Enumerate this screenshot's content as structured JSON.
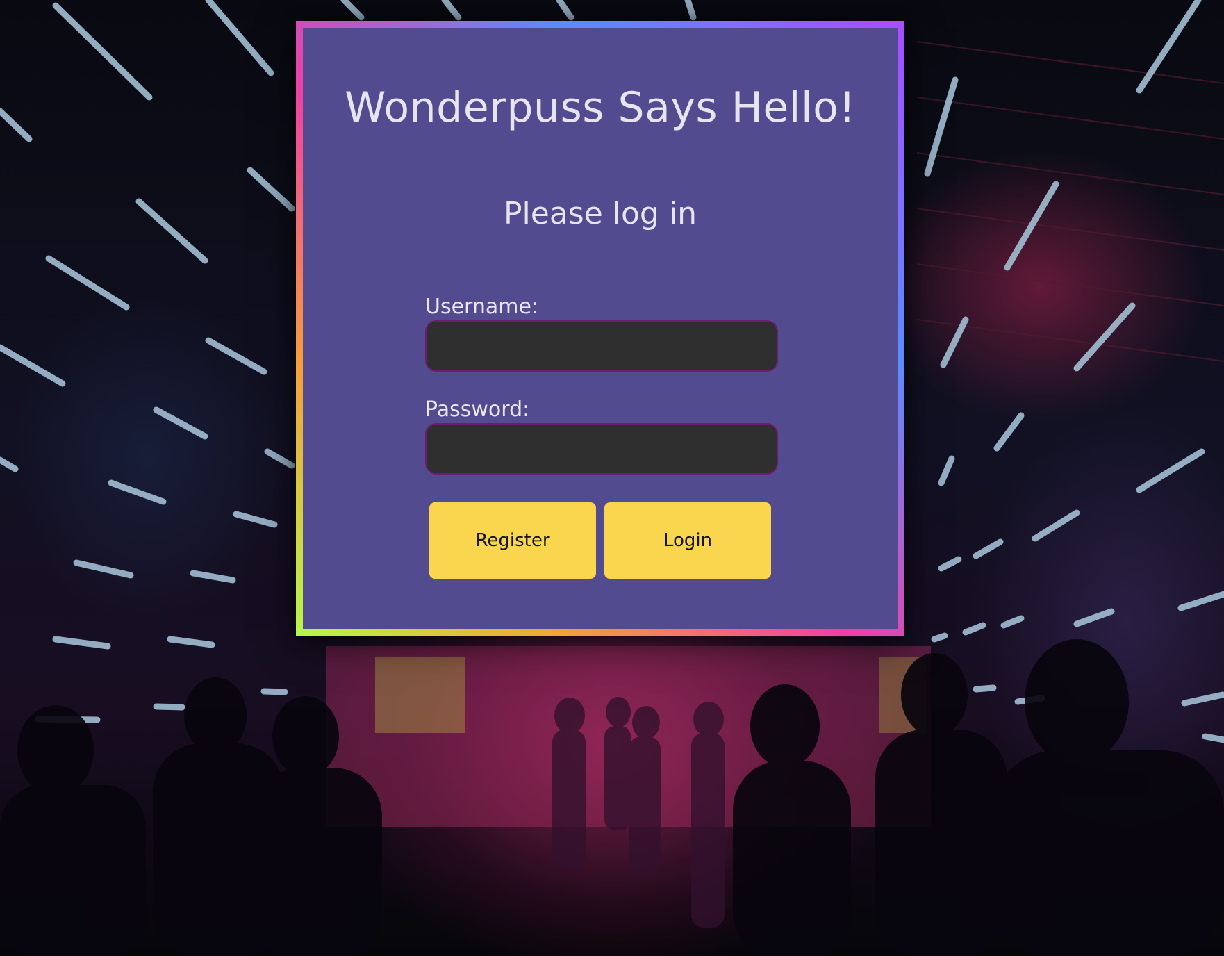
{
  "page": {
    "title": "Wonderpuss Says Hello!",
    "subtitle": "Please log in"
  },
  "form": {
    "username_label": "Username:",
    "username_value": "",
    "password_label": "Password:",
    "password_value": "",
    "register_label": "Register",
    "login_label": "Login"
  },
  "colors": {
    "card_background": "#534b8f",
    "input_background": "#2f2f2f",
    "input_border": "#6d1c6e",
    "button_background": "#fad54e",
    "text_light": "#e8e4ef"
  }
}
